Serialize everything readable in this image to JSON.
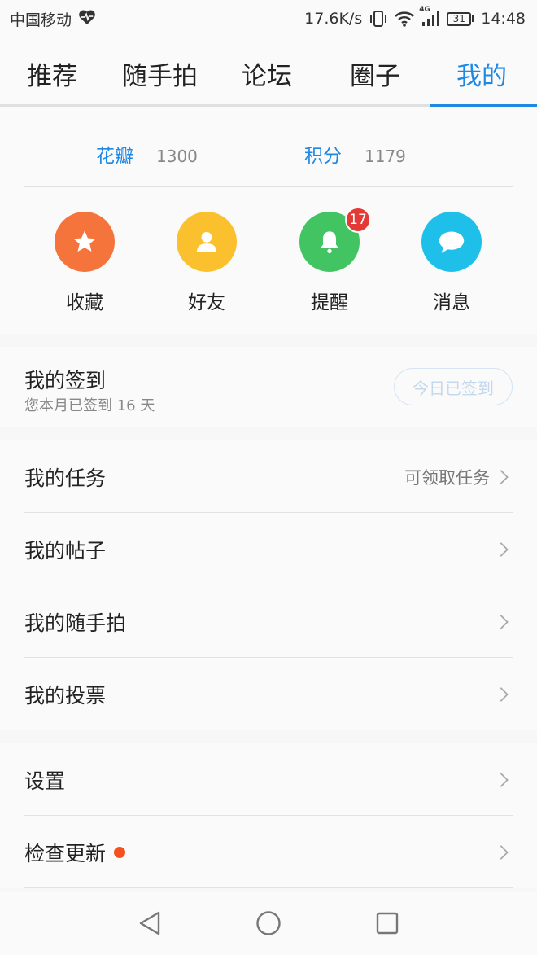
{
  "status_bar": {
    "carrier": "中国移动",
    "net_speed": "17.6K/s",
    "network_type": "4G",
    "battery": "31",
    "time": "14:48"
  },
  "tabs": [
    {
      "label": "推荐",
      "active": false
    },
    {
      "label": "随手拍",
      "active": false
    },
    {
      "label": "论坛",
      "active": false
    },
    {
      "label": "圈子",
      "active": false
    },
    {
      "label": "我的",
      "active": true
    }
  ],
  "stats": [
    {
      "label": "花瓣",
      "value": "1300"
    },
    {
      "label": "积分",
      "value": "1179"
    }
  ],
  "shortcuts": [
    {
      "label": "收藏",
      "icon": "star-icon",
      "color": "#f4743b"
    },
    {
      "label": "好友",
      "icon": "person-icon",
      "color": "#fbc02d"
    },
    {
      "label": "提醒",
      "icon": "bell-icon",
      "color": "#43c463",
      "badge": "17"
    },
    {
      "label": "消息",
      "icon": "chat-bubble-icon",
      "color": "#1ebfe8"
    }
  ],
  "sign_in": {
    "title": "我的签到",
    "subtitle": "您本月已签到 16 天",
    "button": "今日已签到"
  },
  "list_group_1": [
    {
      "label": "我的任务",
      "right_text": "可领取任务"
    },
    {
      "label": "我的帖子",
      "right_text": ""
    },
    {
      "label": "我的随手拍",
      "right_text": ""
    },
    {
      "label": "我的投票",
      "right_text": ""
    }
  ],
  "list_group_2": [
    {
      "label": "设置",
      "dot": false
    },
    {
      "label": "检查更新",
      "dot": true
    }
  ],
  "colors": {
    "accent": "#1e88e5",
    "badge": "#e53935",
    "update_dot": "#f4511e"
  }
}
